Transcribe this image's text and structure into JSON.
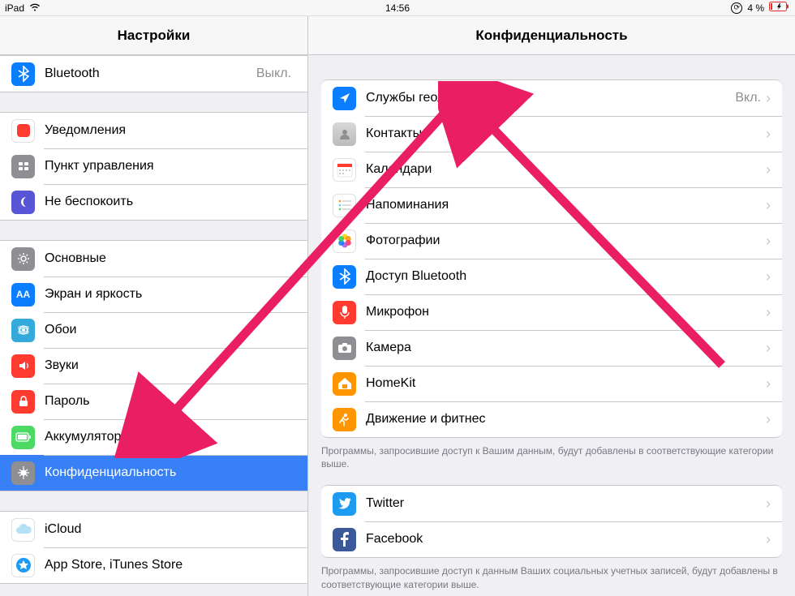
{
  "statusbar": {
    "device": "iPad",
    "time": "14:56",
    "battery_pct": "4 %"
  },
  "sidebar": {
    "title": "Настройки",
    "groups": [
      {
        "items": [
          {
            "icon": "bluetooth",
            "label": "Bluetooth",
            "value": "Выкл."
          }
        ]
      },
      {
        "items": [
          {
            "icon": "notify",
            "label": "Уведомления"
          },
          {
            "icon": "control",
            "label": "Пункт управления"
          },
          {
            "icon": "dnd",
            "label": "Не беспокоить"
          }
        ]
      },
      {
        "items": [
          {
            "icon": "general",
            "label": "Основные"
          },
          {
            "icon": "display",
            "label": "Экран и яркость"
          },
          {
            "icon": "wallpaper",
            "label": "Обои"
          },
          {
            "icon": "sounds",
            "label": "Звуки"
          },
          {
            "icon": "passcode",
            "label": "Пароль"
          },
          {
            "icon": "battery",
            "label": "Аккумулятор"
          },
          {
            "icon": "privacy",
            "label": "Конфиденциальность",
            "selected": true
          }
        ]
      },
      {
        "items": [
          {
            "icon": "icloud",
            "label": "iCloud"
          },
          {
            "icon": "appstore",
            "label": "App Store, iTunes Store"
          }
        ]
      }
    ]
  },
  "detail": {
    "title": "Конфиденциальность",
    "groups": [
      {
        "items": [
          {
            "icon": "location",
            "label": "Службы геолокации",
            "value": "Вкл."
          },
          {
            "icon": "contacts",
            "label": "Контакты"
          },
          {
            "icon": "calendar",
            "label": "Календари"
          },
          {
            "icon": "reminders",
            "label": "Напоминания"
          },
          {
            "icon": "photos",
            "label": "Фотографии"
          },
          {
            "icon": "btaccess",
            "label": "Доступ Bluetooth"
          },
          {
            "icon": "mic",
            "label": "Микрофон"
          },
          {
            "icon": "camera",
            "label": "Камера"
          },
          {
            "icon": "homekit",
            "label": "HomeKit"
          },
          {
            "icon": "motion",
            "label": "Движение и фитнес"
          }
        ],
        "footer": "Программы, запросившие доступ к Вашим данным, будут добавлены в соответствующие категории выше."
      },
      {
        "items": [
          {
            "icon": "twitter",
            "label": "Twitter"
          },
          {
            "icon": "facebook",
            "label": "Facebook"
          }
        ],
        "footer": "Программы, запросившие доступ к данным Ваших социальных учетных записей, будут добавлены в соответствующие категории выше."
      }
    ]
  }
}
